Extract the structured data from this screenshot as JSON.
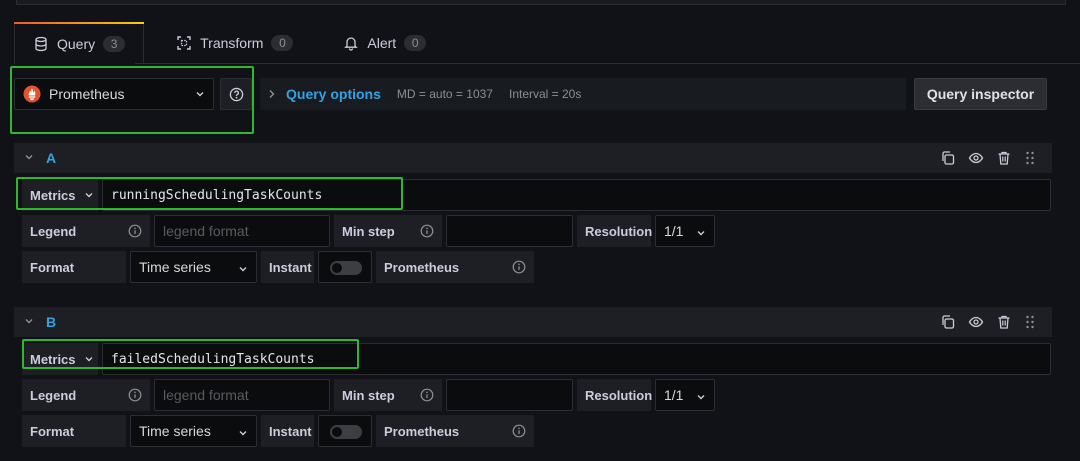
{
  "tabs": [
    {
      "label": "Query",
      "count": "3",
      "icon": "database-icon"
    },
    {
      "label": "Transform",
      "count": "0",
      "icon": "transform-icon"
    },
    {
      "label": "Alert",
      "count": "0",
      "icon": "bell-icon"
    }
  ],
  "datasource": {
    "name": "Prometheus",
    "query_options_label": "Query options",
    "md": "MD = auto = 1037",
    "interval": "Interval = 20s",
    "inspector_label": "Query inspector"
  },
  "queries": [
    {
      "ref": "A",
      "metrics_label": "Metrics",
      "metrics_value": "runningSchedulingTaskCounts",
      "legend_label": "Legend",
      "legend_placeholder": "legend format",
      "minstep_label": "Min step",
      "resolution_label": "Resolution",
      "resolution_value": "1/1",
      "format_label": "Format",
      "format_value": "Time series",
      "instant_label": "Instant",
      "instant_on": false,
      "ds_label": "Prometheus"
    },
    {
      "ref": "B",
      "metrics_label": "Metrics",
      "metrics_value": "failedSchedulingTaskCounts",
      "legend_label": "Legend",
      "legend_placeholder": "legend format",
      "minstep_label": "Min step",
      "resolution_label": "Resolution",
      "resolution_value": "1/1",
      "format_label": "Format",
      "format_value": "Time series",
      "instant_label": "Instant",
      "instant_on": false,
      "ds_label": "Prometheus"
    }
  ],
  "colors": {
    "accent_blue": "#33a2e5",
    "highlight_green": "#2eb82e",
    "prometheus_orange": "#e6522c"
  }
}
